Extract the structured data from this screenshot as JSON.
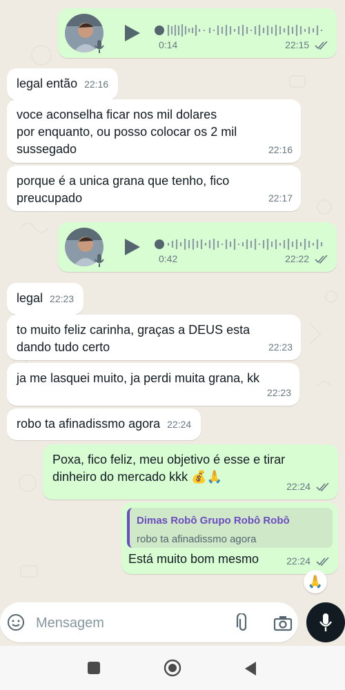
{
  "chat": {
    "voice_messages": [
      {
        "duration": "0:14",
        "time": "22:15"
      },
      {
        "duration": "0:42",
        "time": "22:22"
      }
    ],
    "messages": [
      {
        "text": "legal então",
        "time": "22:16"
      },
      {
        "text": "voce aconselha ficar nos mil dolares\npor enquanto, ou posso colocar os 2 mil\nsussegado",
        "time": "22:16"
      },
      {
        "text": "porque é a unica grana que tenho, fico\npreucupado",
        "time": "22:17"
      },
      {
        "text": "legal",
        "time": "22:23"
      },
      {
        "text": "to muito feliz carinha, graças a DEUS esta\ndando tudo certo",
        "time": "22:23"
      },
      {
        "text": "ja me lasquei muito, ja perdi muita grana, kk",
        "time": "22:23"
      },
      {
        "text": "robo ta afinadissmo agora",
        "time": "22:24"
      },
      {
        "text": "Poxa, fico feliz, meu objetivo é esse e tirar\ndinheiro do mercado kkk 💰🙏",
        "time": "22:24"
      },
      {
        "text": "Está muito bom mesmo",
        "time": "22:24"
      }
    ],
    "reply_quote": {
      "author": "Dimas Robô Grupo Robô Robô",
      "text": "robo ta afinadissmo agora"
    },
    "reaction": "🙏"
  },
  "composer": {
    "placeholder": "Mensagem"
  },
  "colors": {
    "incoming": "#ffffff",
    "outgoing": "#d9fdd3",
    "read_ticks": "#667781",
    "quote_accent": "#6b4bc0"
  },
  "icons": {
    "voice": [
      "avatar",
      "mic-icon",
      "play-icon",
      "waveform"
    ],
    "composer": [
      "sticker-icon",
      "paperclip-icon",
      "camera-icon",
      "mic-icon"
    ],
    "nav": [
      "recents-icon",
      "home-icon",
      "back-icon"
    ]
  }
}
